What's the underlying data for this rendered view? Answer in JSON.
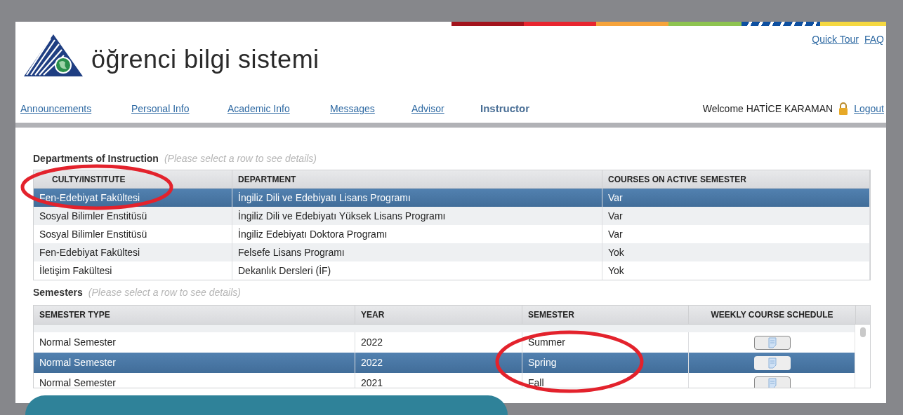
{
  "header": {
    "logo_text": "öğrenci bilgi sistemi",
    "top_links": [
      "Quick Tour",
      "FAQ"
    ],
    "nav": [
      {
        "label": "Announcements",
        "selected": false
      },
      {
        "label": "Personal Info",
        "selected": false
      },
      {
        "label": "Academic Info",
        "selected": false
      },
      {
        "label": "Messages",
        "selected": false
      },
      {
        "label": "Advisor",
        "selected": false
      },
      {
        "label": "Instructor",
        "selected": true
      }
    ],
    "welcome": "Welcome HATİCE KARAMAN",
    "logout": "Logout"
  },
  "departments": {
    "title": "Departments of Instruction",
    "hint": "(Please select a row to see details)",
    "columns": [
      "CULTY/INSTITUTE",
      "DEPARTMENT",
      "COURSES ON ACTIVE SEMESTER"
    ],
    "rows": [
      {
        "cells": [
          "Fen-Edebiyat Fakültesi",
          "İngiliz Dili ve Edebiyatı Lisans Programı",
          "Var"
        ],
        "selected": true
      },
      {
        "cells": [
          "Sosyal Bilimler Enstitüsü",
          "İngiliz Dili ve Edebiyatı Yüksek Lisans Programı",
          "Var"
        ],
        "selected": false
      },
      {
        "cells": [
          "Sosyal Bilimler Enstitüsü",
          "İngiliz Edebiyatı Doktora Programı",
          "Var"
        ],
        "selected": false
      },
      {
        "cells": [
          "Fen-Edebiyat Fakültesi",
          "Felsefe Lisans Programı",
          "Yok"
        ],
        "selected": false
      },
      {
        "cells": [
          "İletişim Fakültesi",
          "Dekanlık Dersleri (İF)",
          "Yok"
        ],
        "selected": false
      }
    ]
  },
  "semesters": {
    "title": "Semesters",
    "hint": "(Please select a row to see details)",
    "columns": [
      "SEMESTER TYPE",
      "YEAR",
      "SEMESTER",
      "WEEKLY COURSE SCHEDULE"
    ],
    "rows": [
      {
        "cells": [
          "Normal Semester",
          "2022",
          "Summer"
        ],
        "selected": false
      },
      {
        "cells": [
          "Normal Semester",
          "2022",
          "Spring"
        ],
        "selected": true
      },
      {
        "cells": [
          "Normal Semester",
          "2021",
          "Fall"
        ],
        "selected": false
      }
    ]
  }
}
